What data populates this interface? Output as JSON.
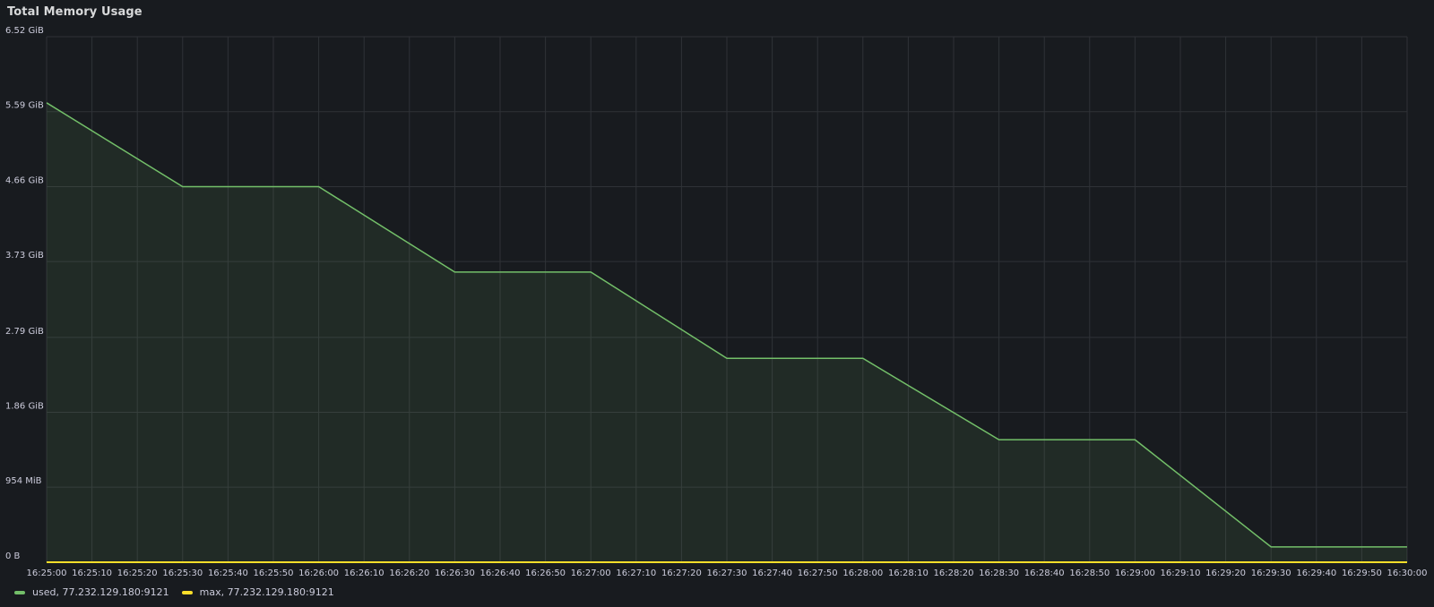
{
  "panel": {
    "title": "Total Memory Usage"
  },
  "colors": {
    "background": "#181b1f",
    "grid": "#2f3237",
    "used": "#73bf69",
    "max": "#fade2a"
  },
  "chart_data": {
    "type": "line",
    "title": "Total Memory Usage",
    "xlabel": "",
    "ylabel": "",
    "y_unit": "GiB",
    "ylim": [
      0,
      6.52
    ],
    "y_ticks": [
      {
        "value": 0,
        "label": "0 B"
      },
      {
        "value": 0.9317,
        "label": "954 MiB"
      },
      {
        "value": 1.86,
        "label": "1.86 GiB"
      },
      {
        "value": 2.79,
        "label": "2.79 GiB"
      },
      {
        "value": 3.73,
        "label": "3.73 GiB"
      },
      {
        "value": 4.66,
        "label": "4.66 GiB"
      },
      {
        "value": 5.59,
        "label": "5.59 GiB"
      },
      {
        "value": 6.52,
        "label": "6.52 GiB"
      }
    ],
    "x_range": [
      "16:25:00",
      "16:30:00"
    ],
    "x_ticks": [
      "16:25:00",
      "16:25:10",
      "16:25:20",
      "16:25:30",
      "16:25:40",
      "16:25:50",
      "16:26:00",
      "16:26:10",
      "16:26:20",
      "16:26:30",
      "16:26:40",
      "16:26:50",
      "16:27:00",
      "16:27:10",
      "16:27:20",
      "16:27:30",
      "16:27:40",
      "16:27:50",
      "16:28:00",
      "16:28:10",
      "16:28:20",
      "16:28:30",
      "16:28:40",
      "16:28:50",
      "16:29:00",
      "16:29:10",
      "16:29:20",
      "16:29:30",
      "16:29:40",
      "16:29:50",
      "16:30:00"
    ],
    "grid": true,
    "legend_position": "bottom-left",
    "series": [
      {
        "name": "used, 77.232.129.180:9121",
        "color": "#73bf69",
        "fill": true,
        "x": [
          "16:25:00",
          "16:25:30",
          "16:26:00",
          "16:26:30",
          "16:27:00",
          "16:27:30",
          "16:28:00",
          "16:28:30",
          "16:28:50",
          "16:29:00",
          "16:29:30",
          "16:30:00"
        ],
        "values": [
          5.7,
          4.66,
          4.66,
          3.6,
          3.6,
          2.53,
          2.53,
          1.52,
          1.52,
          1.52,
          0.19,
          0.19
        ]
      },
      {
        "name": "max, 77.232.129.180:9121",
        "color": "#fade2a",
        "fill": false,
        "x": [
          "16:25:00",
          "16:30:00"
        ],
        "values": [
          0,
          0
        ]
      }
    ]
  }
}
